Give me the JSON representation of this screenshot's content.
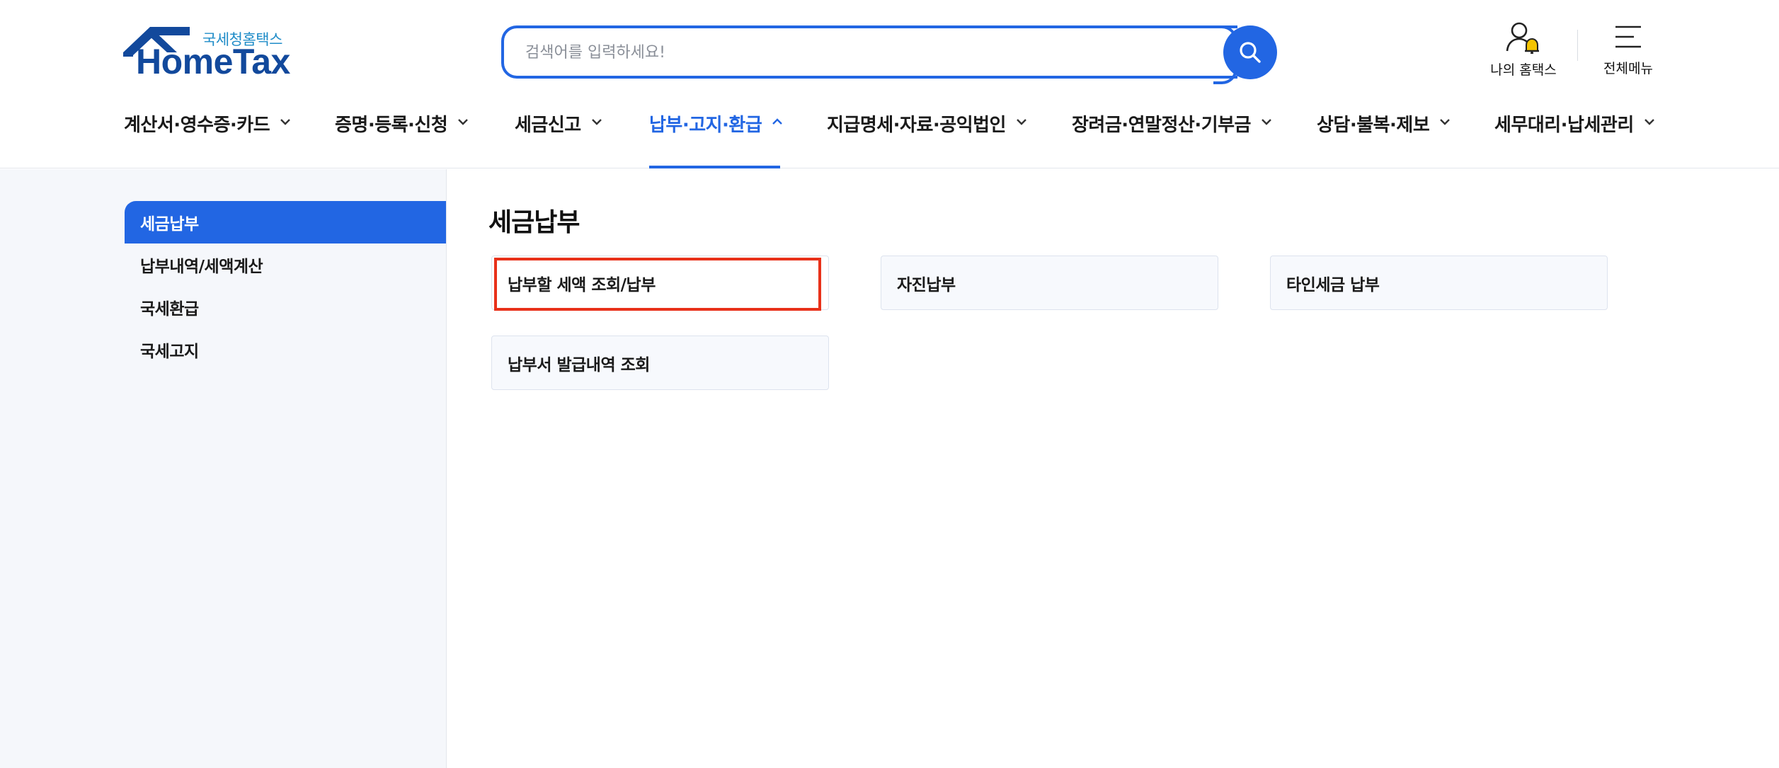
{
  "header": {
    "logo": {
      "sub_text": "국세청홈택스",
      "main_text": "HomeTax"
    },
    "search": {
      "placeholder": "검색어를 입력하세요!",
      "value": ""
    },
    "utility": {
      "my_hometax_label": "나의 홈택스",
      "all_menu_label": "전체메뉴"
    },
    "gnb": [
      {
        "label": "계산서·영수증·카드",
        "active": false
      },
      {
        "label": "증명·등록·신청",
        "active": false
      },
      {
        "label": "세금신고",
        "active": false
      },
      {
        "label": "납부·고지·환급",
        "active": true
      },
      {
        "label": "지급명세·자료·공익법인",
        "active": false
      },
      {
        "label": "장려금·연말정산·기부금",
        "active": false
      },
      {
        "label": "상담·불복·제보",
        "active": false
      },
      {
        "label": "세무대리·납세관리",
        "active": false
      }
    ]
  },
  "sidebar": {
    "items": [
      {
        "label": "세금납부",
        "active": true
      },
      {
        "label": "납부내역/세액계산",
        "active": false
      },
      {
        "label": "국세환급",
        "active": false
      },
      {
        "label": "국세고지",
        "active": false
      }
    ]
  },
  "main": {
    "title": "세금납부",
    "cards": [
      {
        "label": "납부할 세액 조회/납부",
        "highlighted": true
      },
      {
        "label": "자진납부",
        "highlighted": false
      },
      {
        "label": "타인세금 납부",
        "highlighted": false
      },
      {
        "label": "납부서 발급내역 조회",
        "highlighted": false
      }
    ]
  },
  "colors": {
    "primary": "#2266e3",
    "logo_blue": "#12499c",
    "logo_sub": "#1f8cc8",
    "highlight_box": "#e8311a",
    "sidebar_bg": "#f5f7fb",
    "bell": "#f5c400"
  },
  "icons": {
    "search": "search-icon",
    "my_hometax": "user-bell-icon",
    "all_menu": "hamburger-menu-icon",
    "dropdown": "chevron-down-icon",
    "dropup": "chevron-up-icon"
  }
}
